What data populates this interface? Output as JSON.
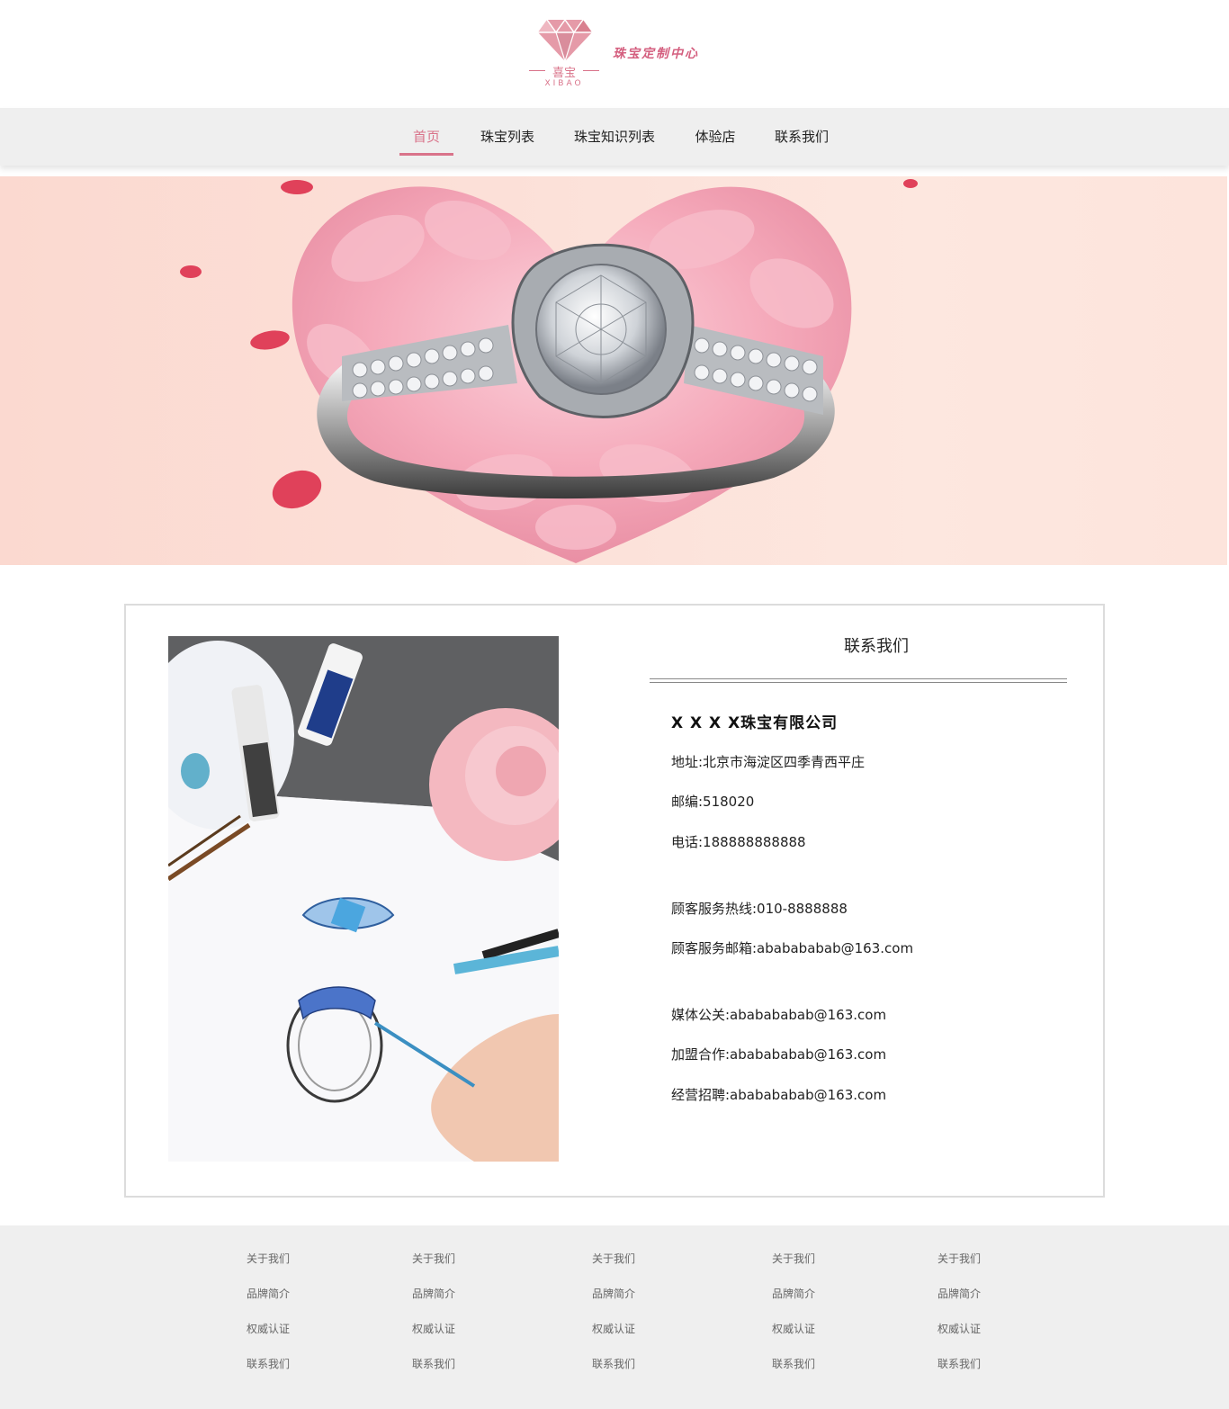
{
  "brand": {
    "logo_cn": "喜宝",
    "logo_en": "XIBAO",
    "tagline": "珠宝定制中心",
    "accent_color": "#d9738a"
  },
  "nav": {
    "items": [
      {
        "label": "首页",
        "active": true
      },
      {
        "label": "珠宝列表",
        "active": false
      },
      {
        "label": "珠宝知识列表",
        "active": false
      },
      {
        "label": "体验店",
        "active": false
      },
      {
        "label": "联系我们",
        "active": false
      }
    ]
  },
  "contact": {
    "title": "联系我们",
    "company": "X X X X珠宝有限公司",
    "address": "地址:北京市海淀区四季青西平庄",
    "postcode": "邮编:518020",
    "phone": "电话:188888888888",
    "hotline": "顾客服务热线:010-8888888",
    "service_email": "顾客服务邮箱:ababababab@163.com",
    "media": "媒体公关:ababababab@163.com",
    "franchise": "加盟合作:ababababab@163.com",
    "recruit": "经营招聘:ababababab@163.com"
  },
  "footer": {
    "columns": [
      {
        "links": [
          "关于我们",
          "品牌简介",
          "权威认证",
          "联系我们"
        ]
      },
      {
        "links": [
          "关于我们",
          "品牌简介",
          "权威认证",
          "联系我们"
        ]
      },
      {
        "links": [
          "关于我们",
          "品牌简介",
          "权威认证",
          "联系我们"
        ]
      },
      {
        "links": [
          "关于我们",
          "品牌简介",
          "权威认证",
          "联系我们"
        ]
      },
      {
        "links": [
          "关于我们",
          "品牌简介",
          "权威认证",
          "联系我们"
        ]
      }
    ]
  }
}
